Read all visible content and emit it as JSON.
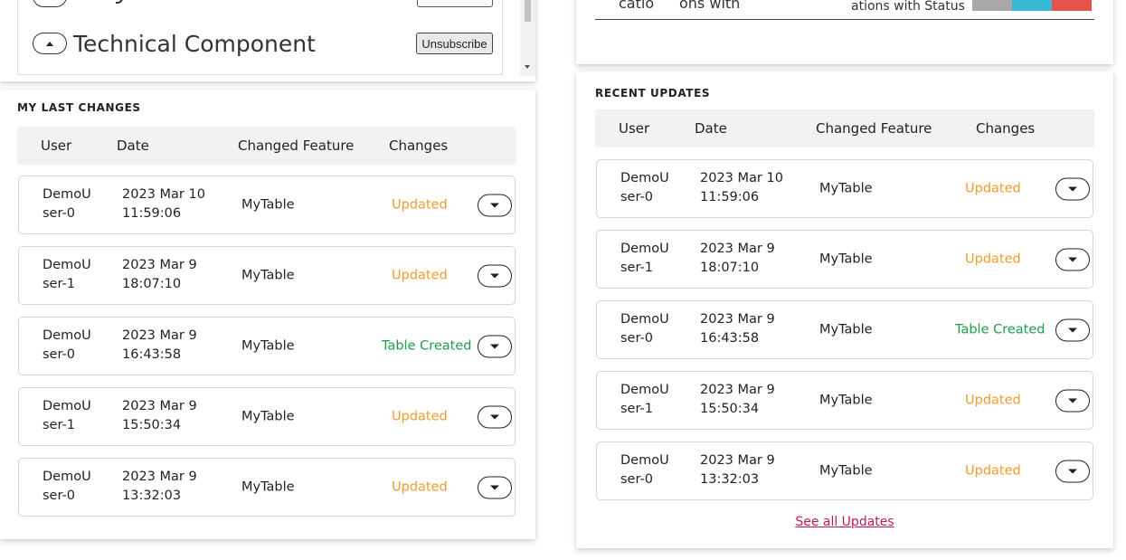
{
  "subscriptions": {
    "items": [
      {
        "title": "Technical Component",
        "button_label": "Unsubscribe"
      }
    ]
  },
  "top_right_table": {
    "headers": [
      "catio",
      "ons with",
      "ations with Status"
    ],
    "colors": [
      "#a8a8a8",
      "#3ab8d6",
      "#e5534b"
    ]
  },
  "last_changes": {
    "title": "MY LAST CHANGES",
    "columns": [
      "User",
      "Date",
      "Changed Feature",
      "Changes"
    ],
    "rows": [
      {
        "user": "DemoUser-0",
        "date": "2023 Mar 10 11:59:06",
        "feature": "MyTable",
        "change": "Updated"
      },
      {
        "user": "DemoUser-1",
        "date": "2023 Mar 9 18:07:10",
        "feature": "MyTable",
        "change": "Updated"
      },
      {
        "user": "DemoUser-0",
        "date": "2023 Mar 9 16:43:58",
        "feature": "MyTable",
        "change": "Table Created"
      },
      {
        "user": "DemoUser-1",
        "date": "2023 Mar 9 15:50:34",
        "feature": "MyTable",
        "change": "Updated"
      },
      {
        "user": "DemoUser-0",
        "date": "2023 Mar 9 13:32:03",
        "feature": "MyTable",
        "change": "Updated"
      }
    ]
  },
  "recent_updates": {
    "title": "RECENT UPDATES",
    "columns": [
      "User",
      "Date",
      "Changed Feature",
      "Changes"
    ],
    "rows": [
      {
        "user": "DemoUser-0",
        "date": "2023 Mar 10 11:59:06",
        "feature": "MyTable",
        "change": "Updated"
      },
      {
        "user": "DemoUser-1",
        "date": "2023 Mar 9 18:07:10",
        "feature": "MyTable",
        "change": "Updated"
      },
      {
        "user": "DemoUser-0",
        "date": "2023 Mar 9 16:43:58",
        "feature": "MyTable",
        "change": "Table Created"
      },
      {
        "user": "DemoUser-1",
        "date": "2023 Mar 9 15:50:34",
        "feature": "MyTable",
        "change": "Updated"
      },
      {
        "user": "DemoUser-0",
        "date": "2023 Mar 9 13:32:03",
        "feature": "MyTable",
        "change": "Updated"
      }
    ],
    "see_all_label": "See all Updates"
  },
  "change_colors": {
    "Updated": "#f29b2a",
    "Table Created": "#1e9e4a"
  }
}
